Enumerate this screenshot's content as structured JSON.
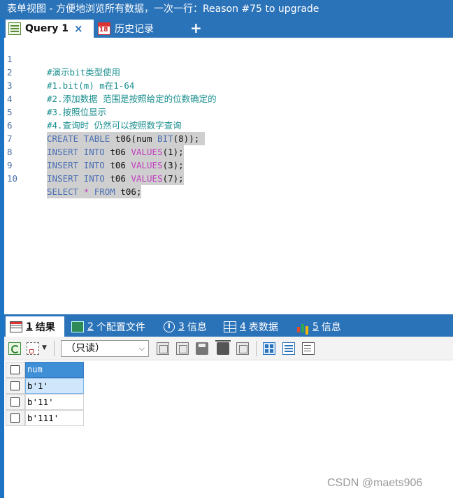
{
  "window": {
    "title": "表单视图 - 方便地浏览所有数据，一次一行：Reason #75 to upgrade"
  },
  "query_tabs": {
    "items": [
      {
        "label": "Query 1",
        "close": "×",
        "active": true
      },
      {
        "label": "历史记录",
        "calendar_day": "18",
        "active": false
      }
    ],
    "add": "+"
  },
  "editor": {
    "lines": [
      {
        "num": "1",
        "text": "#演示bit类型使用"
      },
      {
        "num": "2",
        "text": "#1.bit(m) m在1-64"
      },
      {
        "num": "3",
        "text": "#2.添加数据 范围是按照给定的位数确定的"
      },
      {
        "num": "4",
        "text": "#3.按照位显示"
      },
      {
        "num": "5",
        "text": "#4.查询时 仍然可以按照数字查询"
      },
      {
        "num": "6",
        "kw1": "CREATE TABLE",
        "rest": " t06(num ",
        "kw2": "BIT",
        "tail": "(8));"
      },
      {
        "num": "7",
        "kw1": "INSERT INTO",
        "rest": " t06 ",
        "fn": "VALUES",
        "tail": "(1);"
      },
      {
        "num": "8",
        "kw1": "INSERT INTO",
        "rest": " t06 ",
        "fn": "VALUES",
        "tail": "(3);"
      },
      {
        "num": "9",
        "kw1": "INSERT INTO",
        "rest": " t06 ",
        "fn": "VALUES",
        "tail": "(7);"
      },
      {
        "num": "10",
        "kw1": "SELECT",
        "star": " * ",
        "kw2": "FROM",
        "tail": " t06;"
      }
    ]
  },
  "result_tabs": [
    {
      "num": "1",
      "label": "结果",
      "active": true
    },
    {
      "num": "2",
      "label": "个配置文件",
      "active": false
    },
    {
      "num": "3",
      "label": "信息",
      "active": false
    },
    {
      "num": "4",
      "label": "表数据",
      "active": false
    },
    {
      "num": "5",
      "label": "信息",
      "active": false
    }
  ],
  "toolbar": {
    "readonly_value": "（只读）",
    "dropdown_arrow": "▼",
    "chevron": "⌵"
  },
  "grid": {
    "columns": [
      "num"
    ],
    "rows": [
      "b'1'",
      "b'11'",
      "b'111'"
    ]
  },
  "watermark": "CSDN @maets906",
  "colors": {
    "accent": "#2b73b9",
    "header": "#3f8fd6",
    "selected": "#cfe6fb"
  }
}
